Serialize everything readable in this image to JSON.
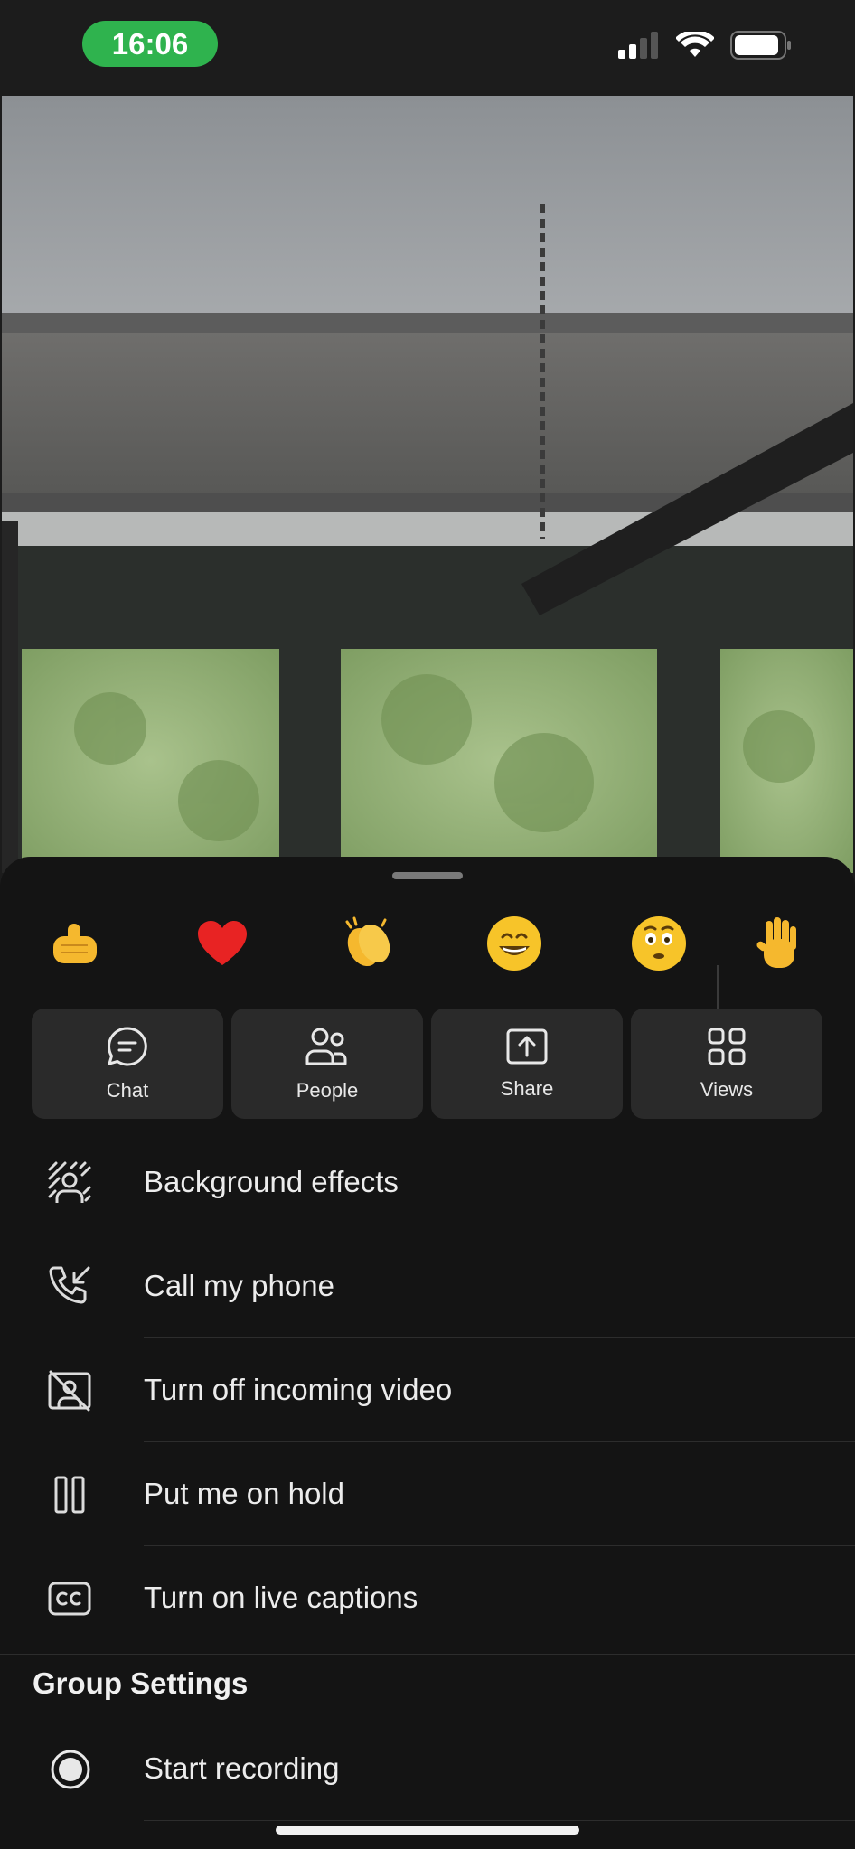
{
  "status_bar": {
    "time": "16:06",
    "icons": [
      "cellular-signal-icon",
      "wifi-icon",
      "battery-icon"
    ]
  },
  "video": {
    "description_icon": "camera-feed"
  },
  "reactions": [
    {
      "name": "thumbs-up-icon"
    },
    {
      "name": "heart-icon"
    },
    {
      "name": "clapping-hands-icon"
    },
    {
      "name": "laughing-face-icon"
    },
    {
      "name": "surprised-face-icon"
    },
    {
      "name": "raise-hand-icon"
    }
  ],
  "actions": [
    {
      "label": "Chat",
      "icon": "chat-icon"
    },
    {
      "label": "People",
      "icon": "people-icon"
    },
    {
      "label": "Share",
      "icon": "share-icon"
    },
    {
      "label": "Views",
      "icon": "views-icon"
    }
  ],
  "menu": [
    {
      "label": "Background effects",
      "icon": "background-effects-icon"
    },
    {
      "label": "Call my phone",
      "icon": "call-my-phone-icon"
    },
    {
      "label": "Turn off incoming video",
      "icon": "video-off-icon"
    },
    {
      "label": "Put me on hold",
      "icon": "hold-icon"
    },
    {
      "label": "Turn on live captions",
      "icon": "captions-icon"
    }
  ],
  "group_settings": {
    "title": "Group Settings",
    "record": {
      "label": "Start recording",
      "icon": "record-icon"
    }
  },
  "colors": {
    "accent_green": "#2fb34e",
    "sheet_bg": "#141414",
    "tile_bg": "#2a2a2a"
  }
}
